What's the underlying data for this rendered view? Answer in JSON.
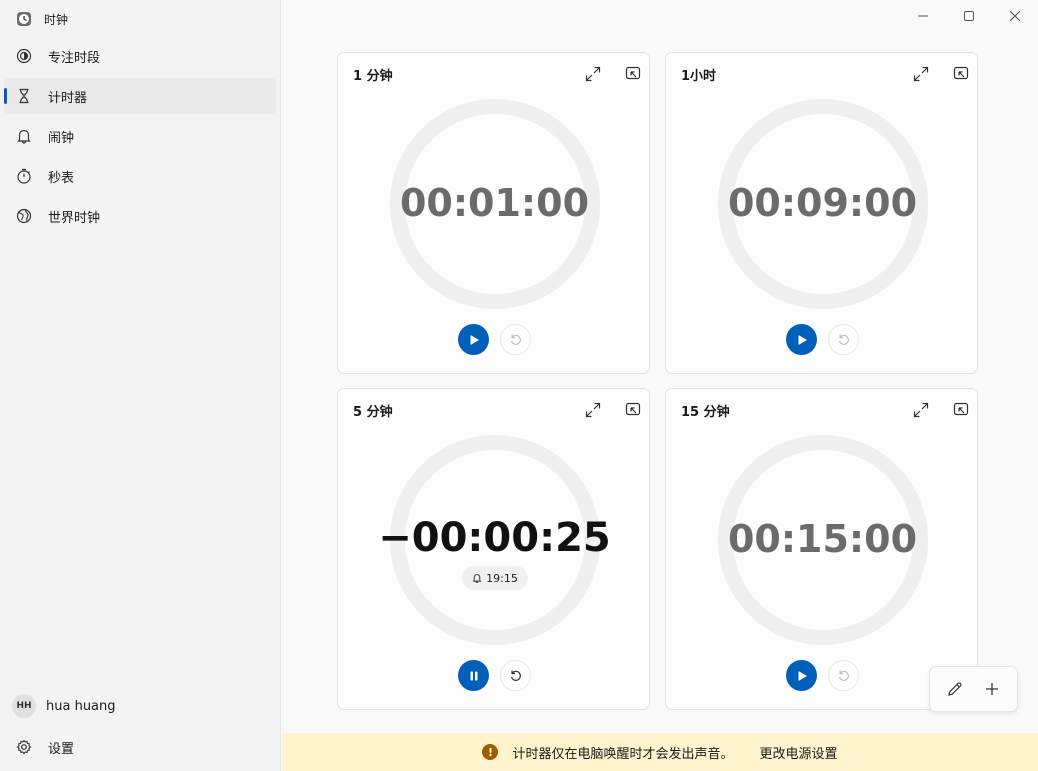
{
  "app": {
    "title": "时钟"
  },
  "sidebar": {
    "items": [
      {
        "label": "专注时段",
        "icon": "focus-icon",
        "active": false
      },
      {
        "label": "计时器",
        "icon": "hourglass-icon",
        "active": true
      },
      {
        "label": "闹钟",
        "icon": "bell-icon",
        "active": false
      },
      {
        "label": "秒表",
        "icon": "stopwatch-icon",
        "active": false
      },
      {
        "label": "世界时钟",
        "icon": "globe-icon",
        "active": false
      }
    ],
    "account": {
      "initials": "HH",
      "name": "hua huang"
    },
    "settings_label": "设置"
  },
  "timers": [
    {
      "title": "1 分钟",
      "time": "00:01:00",
      "state": "idle"
    },
    {
      "title": "1小时",
      "time": "00:09:00",
      "state": "idle"
    },
    {
      "title": "5 分钟",
      "time": "−00:00:25",
      "state": "running",
      "alarm_time": "19:15"
    },
    {
      "title": "15 分钟",
      "time": "00:15:00",
      "state": "idle"
    }
  ],
  "banner": {
    "message": "计时器仅在电脑唤醒时才会发出声音。",
    "link": "更改电源设置"
  },
  "colors": {
    "accent": "#005fb8",
    "banner_bg": "#fff4ce",
    "warning": "#9d5d00"
  }
}
